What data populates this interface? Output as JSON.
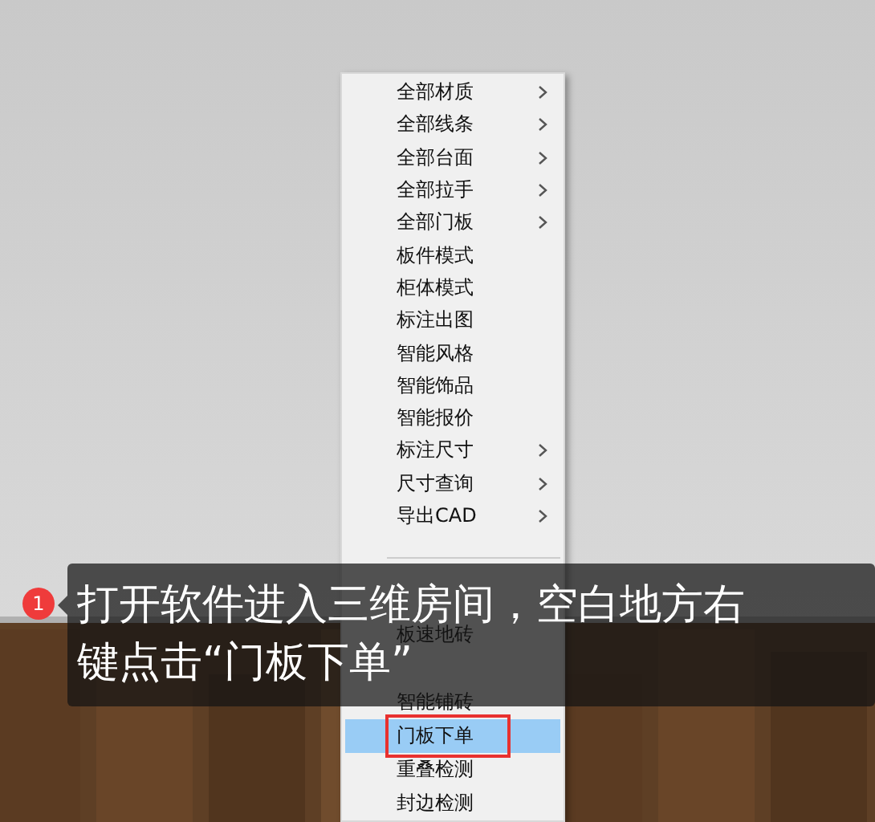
{
  "menu": {
    "items": [
      {
        "kind": "item",
        "label": "全部材质",
        "submenu": true,
        "selected": false
      },
      {
        "kind": "item",
        "label": "全部线条",
        "submenu": true,
        "selected": false
      },
      {
        "kind": "item",
        "label": "全部台面",
        "submenu": true,
        "selected": false
      },
      {
        "kind": "item",
        "label": "全部拉手",
        "submenu": true,
        "selected": false
      },
      {
        "kind": "item",
        "label": "全部门板",
        "submenu": true,
        "selected": false
      },
      {
        "kind": "item",
        "label": "板件模式",
        "submenu": false,
        "selected": false
      },
      {
        "kind": "item",
        "label": "柜体模式",
        "submenu": false,
        "selected": false
      },
      {
        "kind": "item",
        "label": "标注出图",
        "submenu": false,
        "selected": false
      },
      {
        "kind": "item",
        "label": "智能风格",
        "submenu": false,
        "selected": false
      },
      {
        "kind": "item",
        "label": "智能饰品",
        "submenu": false,
        "selected": false
      },
      {
        "kind": "item",
        "label": "智能报价",
        "submenu": false,
        "selected": false
      },
      {
        "kind": "item",
        "label": "标注尺寸",
        "submenu": true,
        "selected": false
      },
      {
        "kind": "item",
        "label": "尺寸查询",
        "submenu": true,
        "selected": false
      },
      {
        "kind": "item",
        "label": "导出CAD",
        "submenu": true,
        "selected": false
      },
      {
        "kind": "separator"
      },
      {
        "kind": "covered"
      },
      {
        "kind": "item",
        "label": "板速地砖",
        "submenu": false,
        "selected": false
      },
      {
        "kind": "covered"
      },
      {
        "kind": "item",
        "label": "智能铺砖",
        "submenu": false,
        "selected": false
      },
      {
        "kind": "item",
        "label": "门板下单",
        "submenu": false,
        "selected": true,
        "highlighted": true
      },
      {
        "kind": "item",
        "label": "重叠检测",
        "submenu": false,
        "selected": false
      },
      {
        "kind": "item",
        "label": "封边检测",
        "submenu": false,
        "selected": false
      }
    ]
  },
  "caption": {
    "step": "1",
    "text": "打开软件进入三维房间，空白地方右键点击“门板下单”"
  }
}
